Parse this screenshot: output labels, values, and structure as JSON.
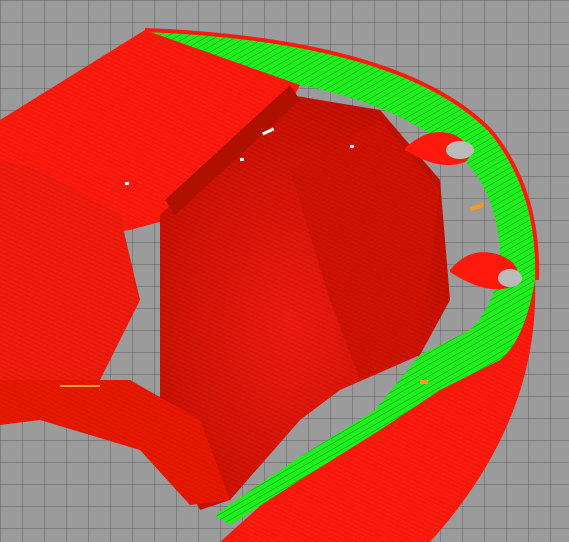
{
  "viewer": {
    "background_color": "#9b9b9b",
    "grid": true
  },
  "model": {
    "colors": {
      "outer_perimeter": "#ff1a0d",
      "inner_wall": "#e01400",
      "shadow_wall": "#c81200",
      "infill_green": "#1ef01e",
      "infill_dark_green": "#0fa00f",
      "highlight_orange": "#ff9a20"
    },
    "features": [
      "outer-wall",
      "inner-wall",
      "green-perimeter-band",
      "teardrop-hole-upper",
      "teardrop-hole-lower"
    ]
  }
}
